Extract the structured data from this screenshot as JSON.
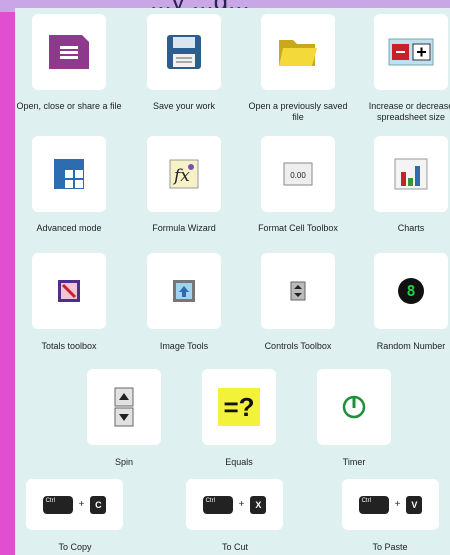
{
  "header": {
    "title_fragment": "...y ...g..."
  },
  "tiles": [
    {
      "label": "Open, close or share a file",
      "icon": "notebook-icon"
    },
    {
      "label": "Save your work",
      "icon": "save-floppy-icon"
    },
    {
      "label": "Open a previously saved file",
      "icon": "folder-open-icon"
    },
    {
      "label": "Increase or decrease spreadsheet size",
      "icon": "resize-grid-icon"
    },
    {
      "label": "Advanced mode",
      "icon": "advanced-grid-icon"
    },
    {
      "label": "Formula Wizard",
      "icon": "formula-wizard-icon"
    },
    {
      "label": "Format Cell Toolbox",
      "icon": "format-cell-icon"
    },
    {
      "label": "Charts",
      "icon": "bar-chart-icon"
    },
    {
      "label": "Totals toolbox",
      "icon": "totals-icon"
    },
    {
      "label": "Image Tools",
      "icon": "image-tools-icon"
    },
    {
      "label": "Controls Toolbox",
      "icon": "controls-spinner-icon"
    },
    {
      "label": "Random Number",
      "icon": "random-number-icon"
    },
    {
      "label": "Spin",
      "icon": "spin-icon"
    },
    {
      "label": "Equals",
      "icon": "equals-icon",
      "glyph": "=?"
    },
    {
      "label": "Timer",
      "icon": "timer-icon"
    }
  ],
  "shortcuts": [
    {
      "label": "To Copy",
      "modifier": "Ctrl",
      "plus": "+",
      "key": "C"
    },
    {
      "label": "To Cut",
      "modifier": "Ctrl",
      "plus": "+",
      "key": "X"
    },
    {
      "label": "To Paste",
      "modifier": "Ctrl",
      "plus": "+",
      "key": "V"
    }
  ],
  "colors": {
    "frame": "#e14fd0",
    "panel": "#dff0f0",
    "tile": "#ffffff",
    "notebook": "#8e3a8c",
    "equals_bg": "#f2f23a"
  },
  "misc": {
    "format_cell_value": "0.00",
    "random_number_digit": "8"
  }
}
